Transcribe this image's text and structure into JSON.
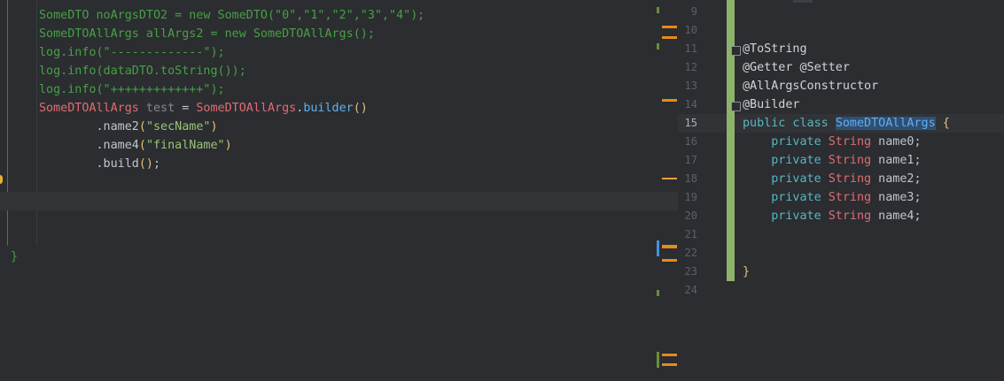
{
  "left_editor": {
    "lines": [
      {
        "parts": [
          {
            "c": "c-cmt",
            "t": "SomeDTO noArgsDTO2 = new SomeDTO(\"0\",\"1\",\"2\",\"3\",\"4\");"
          }
        ]
      },
      {
        "parts": [
          {
            "c": "c-cmt",
            "t": "SomeDTOAllArgs allArgs2 = new SomeDTOAllArgs();"
          }
        ]
      },
      {
        "parts": [
          {
            "c": "c-cmt",
            "t": "log.info(\"-------------\");"
          }
        ]
      },
      {
        "parts": [
          {
            "c": "c-cmt",
            "t": "log.info(dataDTO.toString());"
          }
        ]
      },
      {
        "parts": [
          {
            "c": "c-cmt",
            "t": "log.info(\"+++++++++++++\");"
          }
        ]
      },
      {
        "parts": [
          {
            "c": "c-type",
            "t": "SomeDTOAllArgs"
          },
          {
            "c": "c-var",
            "t": " test "
          },
          {
            "c": "c-pl",
            "t": "= "
          },
          {
            "c": "c-type",
            "t": "SomeDTOAllArgs"
          },
          {
            "c": "c-pl",
            "t": "."
          },
          {
            "c": "c-fn",
            "t": "builder"
          },
          {
            "c": "c-par",
            "t": "()"
          }
        ]
      },
      {
        "parts": [
          {
            "c": "c-pl",
            "t": "        .name2"
          },
          {
            "c": "c-par",
            "t": "("
          },
          {
            "c": "c-str",
            "t": "\"secName\""
          },
          {
            "c": "c-par",
            "t": ")"
          }
        ]
      },
      {
        "parts": [
          {
            "c": "c-pl",
            "t": "        .name4"
          },
          {
            "c": "c-par",
            "t": "("
          },
          {
            "c": "c-str",
            "t": "\"finalName\""
          },
          {
            "c": "c-par",
            "t": ")"
          }
        ]
      },
      {
        "parts": [
          {
            "c": "c-pl",
            "t": "        .build"
          },
          {
            "c": "c-par",
            "t": "()"
          },
          {
            "c": "c-pl",
            "t": ";"
          }
        ]
      }
    ],
    "closing_brace": "}"
  },
  "right_editor": {
    "line_numbers": [
      "9",
      "10",
      "11",
      "12",
      "13",
      "14",
      "15",
      "16",
      "17",
      "18",
      "19",
      "20",
      "21",
      "22",
      "23",
      "24"
    ],
    "current_line": "15",
    "code": [
      {
        "n": "11",
        "parts": [
          {
            "c": "c-ann",
            "t": "@ToString"
          }
        ]
      },
      {
        "n": "12",
        "parts": [
          {
            "c": "c-ann",
            "t": "@Getter @Setter"
          }
        ]
      },
      {
        "n": "13",
        "parts": [
          {
            "c": "c-ann",
            "t": "@AllArgsConstructor"
          }
        ]
      },
      {
        "n": "14",
        "parts": [
          {
            "c": "c-ann",
            "t": "@Builder"
          }
        ]
      },
      {
        "n": "15",
        "parts": [
          {
            "c": "c-kw",
            "t": "public class "
          },
          {
            "c": "sel",
            "t": "SomeDTOAllArgs"
          },
          {
            "c": "c-brace",
            "t": " {"
          }
        ]
      },
      {
        "n": "16",
        "parts": [
          {
            "c": "c-kw",
            "t": "    private "
          },
          {
            "c": "c-type",
            "t": "String"
          },
          {
            "c": "c-pl",
            "t": " name0;"
          }
        ]
      },
      {
        "n": "17",
        "parts": [
          {
            "c": "c-kw",
            "t": "    private "
          },
          {
            "c": "c-type",
            "t": "String"
          },
          {
            "c": "c-pl",
            "t": " name1;"
          }
        ]
      },
      {
        "n": "18",
        "parts": [
          {
            "c": "c-kw",
            "t": "    private "
          },
          {
            "c": "c-type",
            "t": "String"
          },
          {
            "c": "c-pl",
            "t": " name2;"
          }
        ]
      },
      {
        "n": "19",
        "parts": [
          {
            "c": "c-kw",
            "t": "    private "
          },
          {
            "c": "c-type",
            "t": "String"
          },
          {
            "c": "c-pl",
            "t": " name3;"
          }
        ]
      },
      {
        "n": "20",
        "parts": [
          {
            "c": "c-kw",
            "t": "    private "
          },
          {
            "c": "c-type",
            "t": "String"
          },
          {
            "c": "c-pl",
            "t": " name4;"
          }
        ]
      },
      {
        "n": "23",
        "parts": [
          {
            "c": "c-brace",
            "t": "}"
          }
        ]
      }
    ]
  },
  "scrollbar_markers": [
    {
      "color": "#6a8f3c",
      "kind": "green"
    },
    {
      "color": "#e8891c",
      "kind": "orange"
    },
    {
      "color": "#e8891c",
      "kind": "orange"
    },
    {
      "color": "#6a8f3c",
      "kind": "green"
    },
    {
      "color": "#e8891c",
      "kind": "orange"
    },
    {
      "color": "#e8a040",
      "kind": "orange-light"
    },
    {
      "color": "#4a90d9",
      "kind": "blue"
    },
    {
      "color": "#e8891c",
      "kind": "orange"
    },
    {
      "color": "#e8891c",
      "kind": "orange"
    },
    {
      "color": "#6a8f3c",
      "kind": "green"
    },
    {
      "color": "#6a8f3c",
      "kind": "green"
    },
    {
      "color": "#e8891c",
      "kind": "orange"
    },
    {
      "color": "#e8891c",
      "kind": "orange"
    }
  ]
}
